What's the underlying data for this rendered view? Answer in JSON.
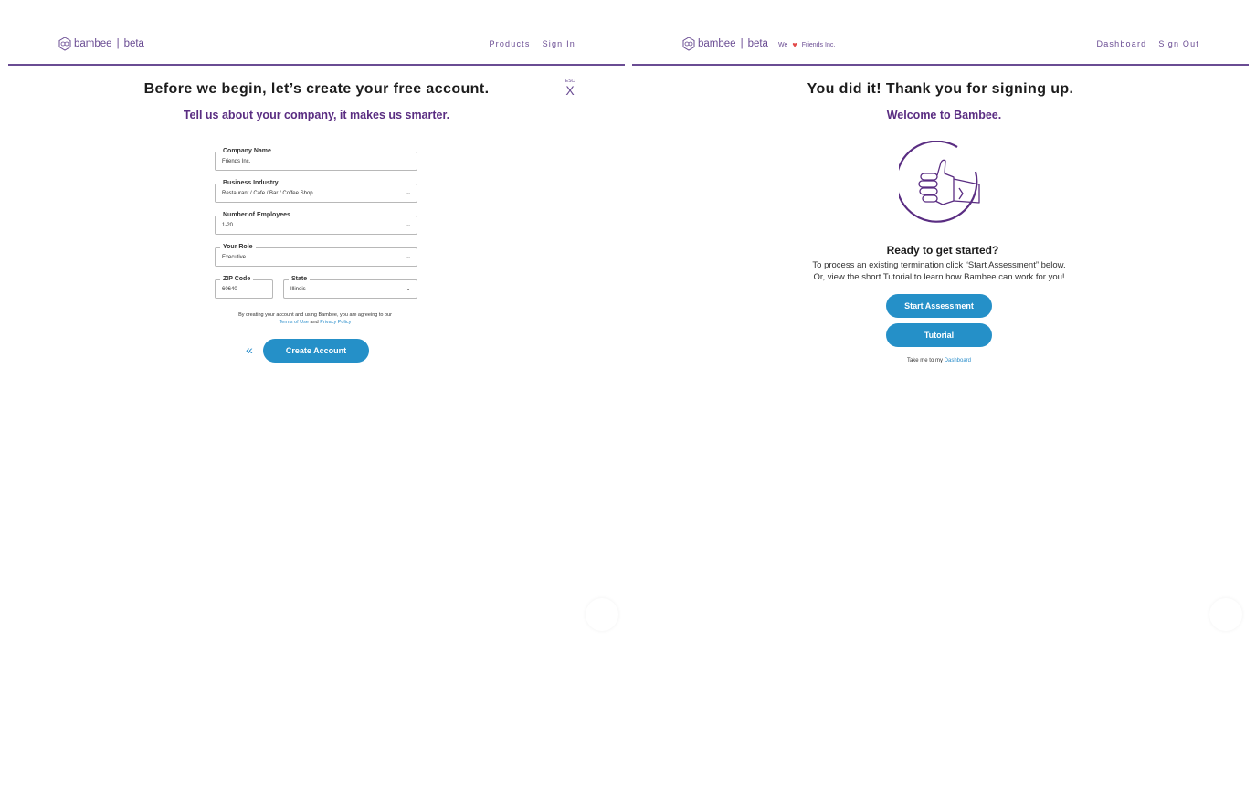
{
  "left": {
    "logo": {
      "brand": "bambee",
      "tag": "beta"
    },
    "nav": [
      "Products",
      "Sign In"
    ],
    "esc": {
      "small": "ESC",
      "x": "X"
    },
    "title": "Before we begin, let’s create your free account.",
    "subtitle": "Tell us about your company, it makes us smarter.",
    "form": {
      "company": {
        "label": "Company Name",
        "value": "Friends Inc."
      },
      "industry": {
        "label": "Business Industry",
        "value": "Restaurant / Cafe / Bar / Coffee Shop"
      },
      "employees": {
        "label": "Number of Employees",
        "value": "1-20"
      },
      "role": {
        "label": "Your Role",
        "value": "Executive"
      },
      "zip": {
        "label": "ZIP Code",
        "value": "60640"
      },
      "state": {
        "label": "State",
        "value": "Illinois"
      }
    },
    "terms": {
      "text": "By creating your account and using Bambee, you are agreeing to our",
      "terms_link": "Terms of Use",
      "and": "and",
      "privacy_link": "Privacy Policy"
    },
    "back": "«",
    "create_button": "Create Account"
  },
  "right": {
    "logo": {
      "brand": "bambee",
      "tag": "beta"
    },
    "we": {
      "text": "We",
      "heart": "♥",
      "company": "Friends Inc."
    },
    "nav": [
      "Dashboard",
      "Sign Out"
    ],
    "title": "You did it! Thank you for signing up.",
    "subtitle": "Welcome to Bambee.",
    "ready": "Ready to get started?",
    "desc_line1": "To process an existing termination click “Start Assessment” below.",
    "desc_line2": "Or, view the short Tutorial to learn how Bambee can work for you!",
    "start_button": "Start Assessment",
    "tutorial_button": "Tutorial",
    "take_me": "Take me to my",
    "dashboard_link": "Dashboard"
  },
  "colors": {
    "brand_purple": "#6a4c93",
    "accent_blue": "#2590c8",
    "heart_red": "#e24a4a"
  }
}
